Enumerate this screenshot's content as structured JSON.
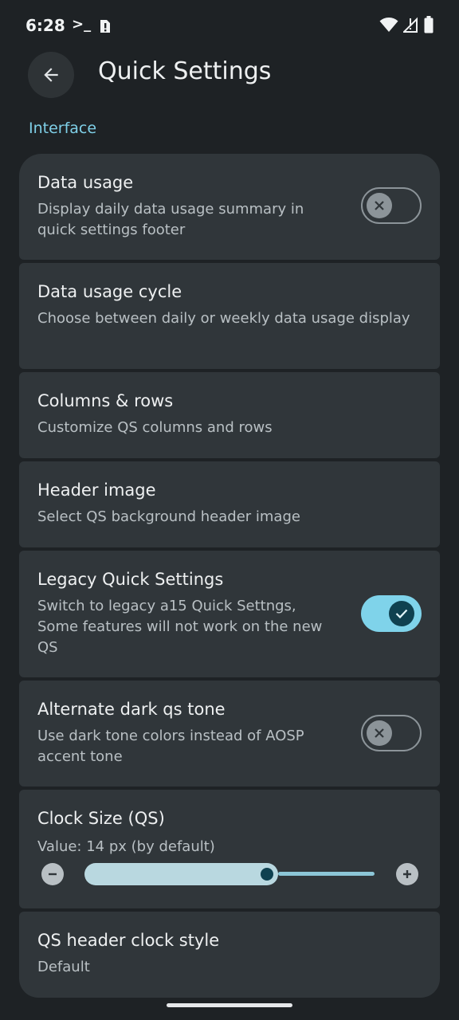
{
  "status_bar": {
    "time": "6:28",
    "terminal_glyph": ">_",
    "icons": [
      "terminal-icon",
      "alert-icon",
      "wifi-icon",
      "signal-icon",
      "battery-icon"
    ]
  },
  "header": {
    "title": "Quick Settings",
    "back_icon": "arrow-back-icon"
  },
  "section": {
    "title": "Interface"
  },
  "items": [
    {
      "title": "Data usage",
      "subtitle": "Display daily data usage summary in quick settings footer",
      "toggle": "off"
    },
    {
      "title": "Data usage cycle",
      "subtitle": "Choose between daily or weekly data usage display"
    },
    {
      "title": "Columns & rows",
      "subtitle": "Customize QS columns and rows"
    },
    {
      "title": "Header image",
      "subtitle": "Select QS background header image"
    },
    {
      "title": "Legacy Quick Settings",
      "subtitle": "Switch to legacy a15 Quick Settngs, Some features will not work on the new QS",
      "toggle": "on"
    },
    {
      "title": "Alternate dark qs tone",
      "subtitle": "Use dark tone colors instead of AOSP accent tone",
      "toggle": "off"
    },
    {
      "title": "Clock Size (QS)",
      "value_text": "Value: 14 px (by default)",
      "slider_fraction": 0.63
    },
    {
      "title": "QS header clock style",
      "subtitle": "Default"
    }
  ],
  "colors": {
    "background": "#1e2225",
    "card": "#30363a",
    "accent": "#7fd3ea",
    "section_header": "#7fd0e8",
    "knob_on": "#0f4150"
  }
}
